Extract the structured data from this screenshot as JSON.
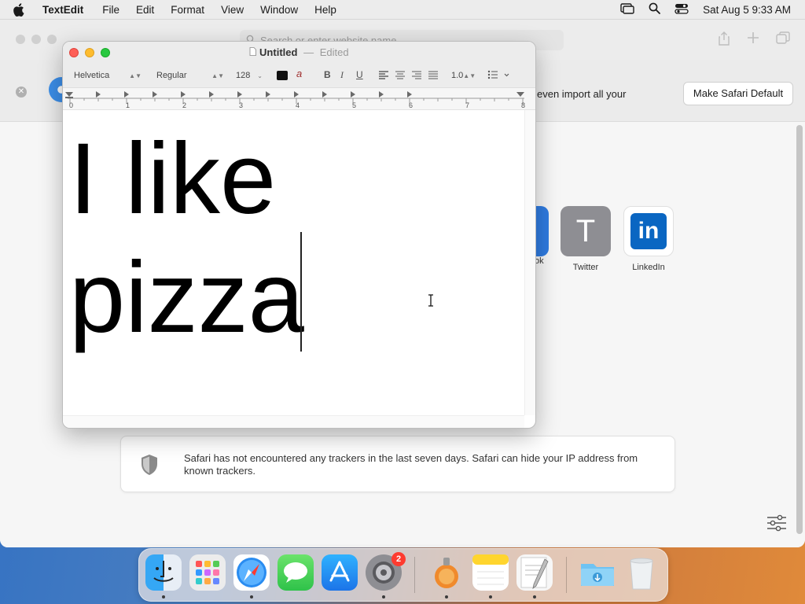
{
  "menubar": {
    "app_name": "TextEdit",
    "menus": [
      "File",
      "Edit",
      "Format",
      "View",
      "Window",
      "Help"
    ],
    "clock": "Sat Aug 5  9:33 AM"
  },
  "safari": {
    "address_placeholder": "Search or enter website name",
    "banner_text": "even import all your",
    "default_button": "Make Safari Default",
    "favorites": {
      "partial_label": "ok",
      "twitter_label": "Twitter",
      "twitter_letter": "T",
      "linkedin_label": "LinkedIn",
      "linkedin_logo": "in"
    },
    "privacy_message": "Safari has not encountered any trackers in the last seven days. Safari can hide your IP address from known trackers."
  },
  "textedit": {
    "doc_name": "Untitled",
    "separator": "—",
    "status": "Edited",
    "toolbar": {
      "font_family": "Helvetica",
      "font_style": "Regular",
      "font_size": "128",
      "bold": "B",
      "italic": "I",
      "underline": "U",
      "line_spacing": "1.0",
      "highlight_glyph": "a"
    },
    "ruler_numbers": [
      "0",
      "1",
      "2",
      "3",
      "4",
      "5",
      "6",
      "7",
      "8"
    ],
    "document_text": "I like\npizza"
  },
  "dock": {
    "apps": [
      "Finder",
      "Launchpad",
      "Safari",
      "Messages",
      "App Store",
      "System Settings",
      "Preview",
      "Notes",
      "TextEdit",
      "Downloads",
      "Trash"
    ],
    "system_settings_badge": "2"
  },
  "colors": {
    "accent_red": "#fe5f57",
    "accent_yellow": "#febc2e",
    "accent_green": "#28c840",
    "linkedin_blue": "#0a66c2"
  }
}
